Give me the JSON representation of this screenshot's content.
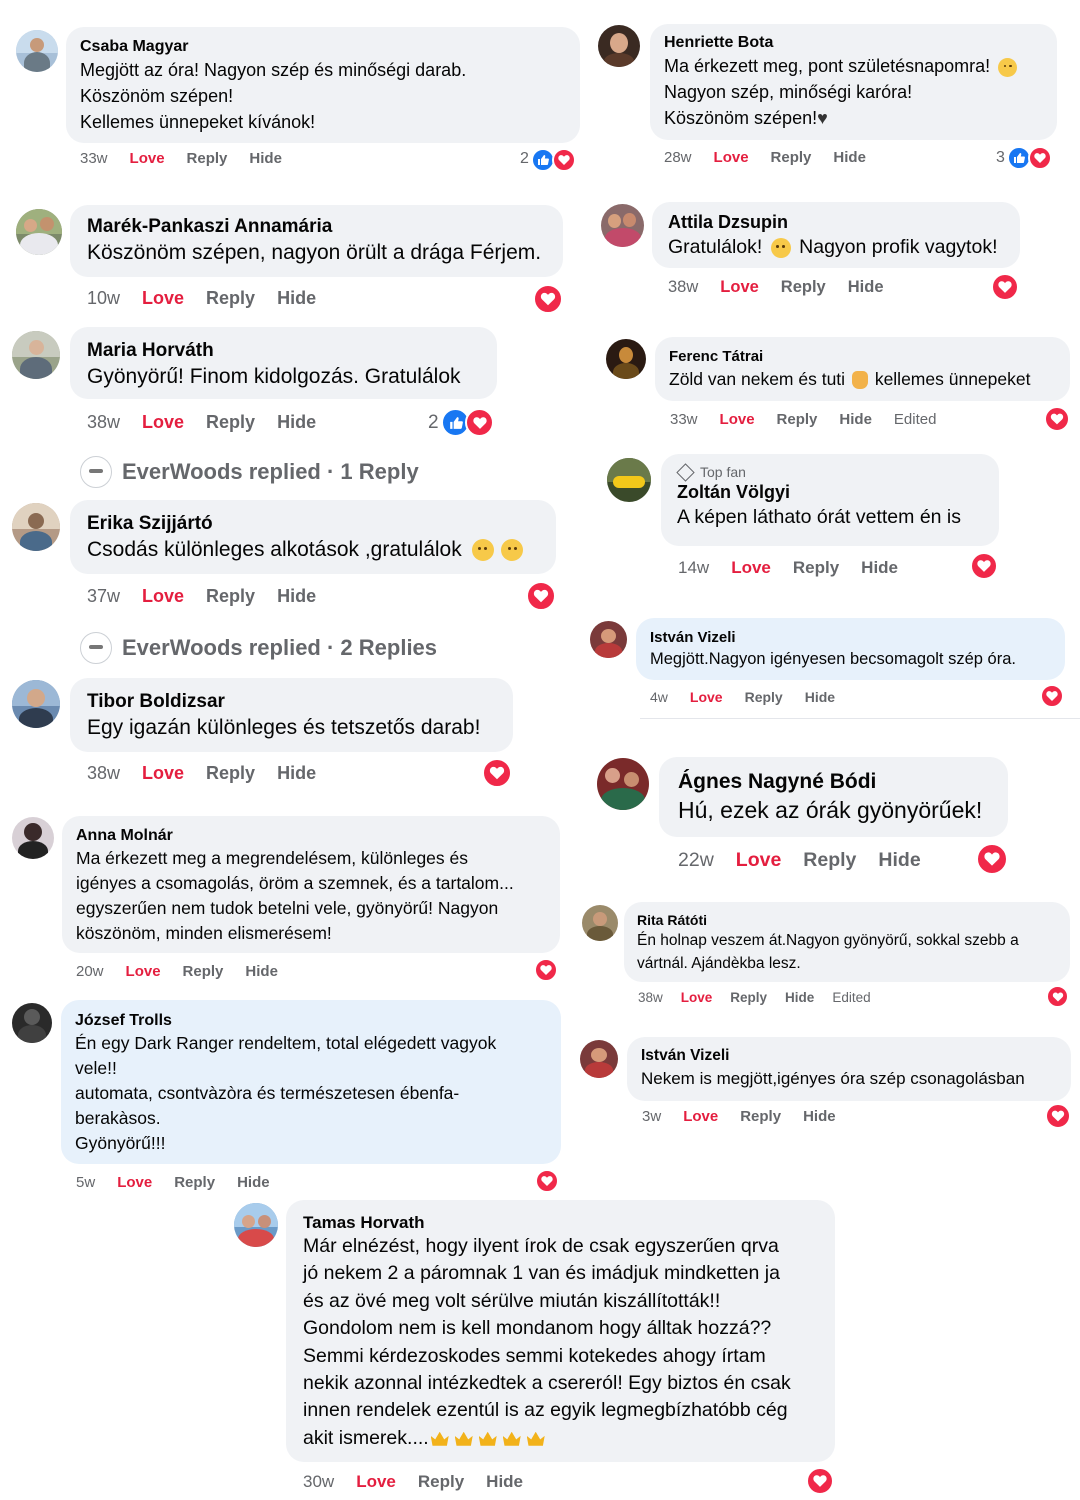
{
  "comments": [
    {
      "name": "Csaba Magyar",
      "text": "Megjött az óra! Nagyon szép és minőségi darab.\nKöszönöm szépen!\nKellemes ünnepeket kívánok!",
      "time": "33w",
      "love": "Love",
      "reply": "Reply",
      "hide": "Hide",
      "reaction_count": "2"
    },
    {
      "name": "Henriette Bota",
      "text": "Ma érkezett meg, pont születésnapomra!",
      "text2": "Nagyon szép, minőségi karóra!\nKöszönöm szépen!",
      "time": "28w",
      "love": "Love",
      "reply": "Reply",
      "hide": "Hide",
      "reaction_count": "3"
    },
    {
      "name": "Marék-Pankaszi Annamária",
      "text": "Köszönöm szépen, nagyon örült a drága Férjem.",
      "time": "10w",
      "love": "Love",
      "reply": "Reply",
      "hide": "Hide"
    },
    {
      "name": "Attila Dzsupin",
      "text": "Gratulálok!",
      "text2": "Nagyon profik vagytok!",
      "time": "38w",
      "love": "Love",
      "reply": "Reply",
      "hide": "Hide"
    },
    {
      "name": "Maria Horváth",
      "text": "Gyönyörű! Finom kidolgozás. Gratulálok",
      "time": "38w",
      "love": "Love",
      "reply": "Reply",
      "hide": "Hide",
      "reaction_count": "2"
    },
    {
      "name": "Ferenc Tátrai",
      "text": "Zöld van nekem és tuti",
      "text2": "kellemes ünnepeket",
      "time": "33w",
      "love": "Love",
      "reply": "Reply",
      "hide": "Hide",
      "edited": "Edited"
    },
    {
      "name": "Erika Szijjártó",
      "text": "Csodás különleges alkotások ,gratulálok",
      "time": "37w",
      "love": "Love",
      "reply": "Reply",
      "hide": "Hide"
    },
    {
      "badge": "Top fan",
      "name": "Zoltán Völgyi",
      "text": "A képen láthato órát vettem én is",
      "time": "14w",
      "love": "Love",
      "reply": "Reply",
      "hide": "Hide"
    },
    {
      "name": "István Vizeli",
      "text": "Megjött.Nagyon igényesen becsomagolt szép óra.",
      "time": "4w",
      "love": "Love",
      "reply": "Reply",
      "hide": "Hide"
    },
    {
      "name": "Tibor Boldizsar",
      "text": "Egy igazán különleges és tetszetős darab!",
      "time": "38w",
      "love": "Love",
      "reply": "Reply",
      "hide": "Hide"
    },
    {
      "name": "Ágnes Nagyné Bódi",
      "text": "Hú, ezek az órák gyönyörűek!",
      "time": "22w",
      "love": "Love",
      "reply": "Reply",
      "hide": "Hide"
    },
    {
      "name": "Anna Molnár",
      "text": "Ma érkezett meg a megrendelésem, különleges és\nigényes a csomagolás, öröm a szemnek, és a tartalom...\negyszerűen nem tudok betelni vele, gyönyörű! Nagyon\nköszönöm, minden elismerésem!",
      "time": "20w",
      "love": "Love",
      "reply": "Reply",
      "hide": "Hide"
    },
    {
      "name": "Rita Rátóti",
      "text": "Én holnap veszem át.Nagyon gyönyörű, sokkal szebb a\nvártnál. Ajándèkba lesz.",
      "time": "38w",
      "love": "Love",
      "reply": "Reply",
      "hide": "Hide",
      "edited": "Edited"
    },
    {
      "name": "József Trolls",
      "text": "Én egy Dark Ranger rendeltem, total elégedett vagyok\nvele!!\nautomata, csontvàzòra és természetesen ébenfa-\nberakàsos.\nGyönyörű!!!",
      "time": "5w",
      "love": "Love",
      "reply": "Reply",
      "hide": "Hide"
    },
    {
      "name": "István Vizeli",
      "text": "Nekem is megjött,igényes óra szép csonagolásban",
      "time": "3w",
      "love": "Love",
      "reply": "Reply",
      "hide": "Hide"
    },
    {
      "name": "Tamas Horvath",
      "text": "Már elnézést, hogy ilyent írok de csak egyszerűen qrva\njó nekem 2 a páromnak 1 van és imádjuk mindketten ja\nés az övé meg volt sérülve miután kiszállították!!\nGondolom nem is kell mondanom hogy álltak hozzá??\nSemmi kérdezoskodes semmi kotekedes ahogy írtam\nnekik azonnal intézkedtek a csereról! Egy biztos én csak\ninnen rendelek ezentúl is az egyik legmegbízhatóbb cég\nakit ismerek....",
      "time": "30w",
      "love": "Love",
      "reply": "Reply",
      "hide": "Hide"
    }
  ],
  "replies": [
    {
      "text": "EverWoods replied · 1 Reply"
    },
    {
      "text": "EverWoods replied · 2 Replies"
    }
  ],
  "icons": {
    "heart": "heart-reaction-icon",
    "like": "like-reaction-icon"
  },
  "colors": {
    "love": "#e41e3f",
    "heart": "#f02849",
    "like": "#1877f2",
    "bubble": "#f0f2f5",
    "bubble_highlight": "#e7f1fb"
  }
}
